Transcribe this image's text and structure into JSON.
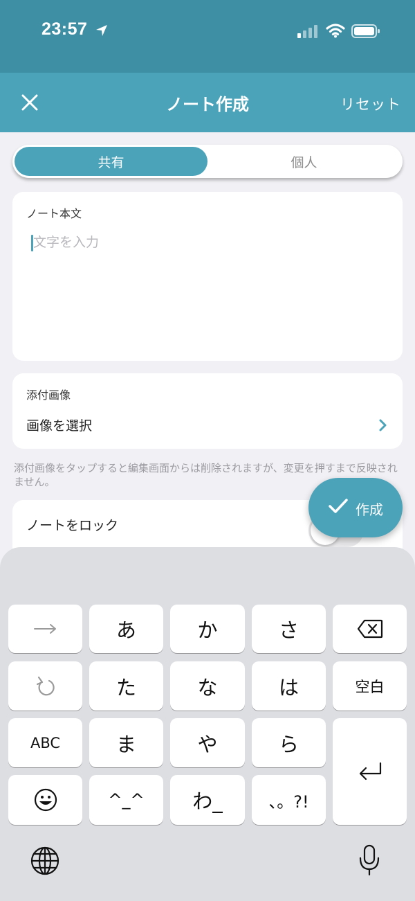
{
  "status_bar": {
    "time": "23:57",
    "icons": [
      "location-arrow-icon",
      "cellular-signal-icon",
      "wifi-icon",
      "battery-icon"
    ]
  },
  "nav": {
    "title": "ノート作成",
    "reset_label": "リセット",
    "close_icon": "close-icon"
  },
  "segment": {
    "shared_label": "共有",
    "personal_label": "個人",
    "selected": "共有"
  },
  "body_card": {
    "label": "ノート本文",
    "placeholder": "文字を入力",
    "value": ""
  },
  "image_card": {
    "label": "添付画像",
    "select_label": "画像を選択"
  },
  "note_text": "添付画像をタップすると編集画面からは削除されますが、変更を押すまで反映されません。",
  "lock": {
    "label": "ノートをロック",
    "enabled": false
  },
  "fab": {
    "label": "作成"
  },
  "keyboard": {
    "row1": [
      "→",
      "あ",
      "か",
      "さ",
      "delete-icon"
    ],
    "row2": [
      "undo-icon",
      "た",
      "な",
      "は",
      "空白"
    ],
    "row3": [
      "ABC",
      "ま",
      "や",
      "ら"
    ],
    "row4": [
      "emoji-icon",
      "^_^",
      "わ_",
      "、。?!"
    ],
    "return_key": "return-icon",
    "globe_key": "globe-icon",
    "mic_key": "microphone-icon"
  },
  "colors": {
    "status_bar": "#3E8FA3",
    "nav_bar": "#4BA3BA",
    "accent": "#4BA3BA",
    "background": "#F1F1F5",
    "keyboard_bg": "#DDDEE2"
  }
}
